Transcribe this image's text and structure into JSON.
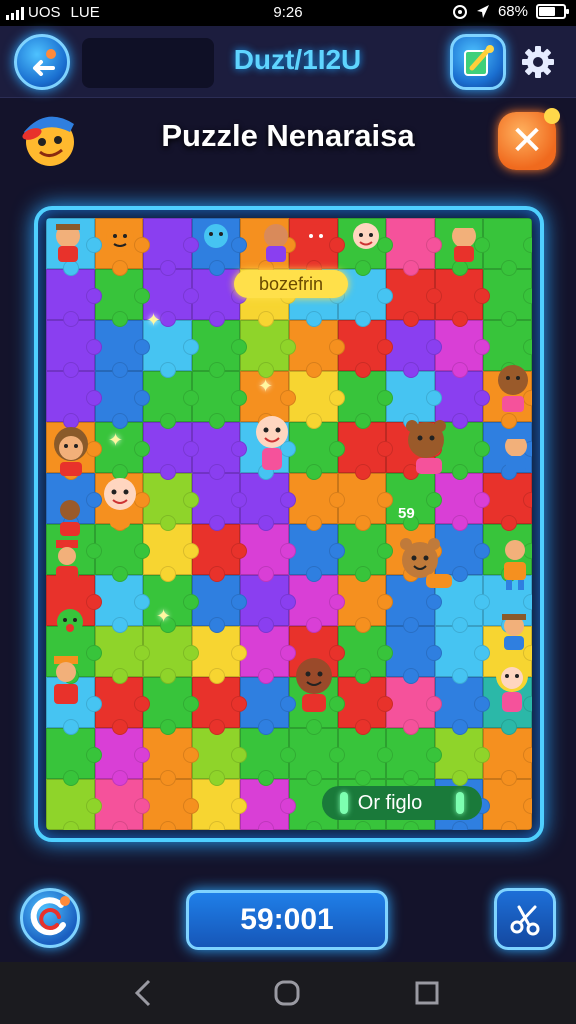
{
  "status_bar": {
    "carrier": "UOS",
    "network": "LUE",
    "time": "9:26",
    "battery": "68%",
    "battery_level": 0.68
  },
  "top_bar": {
    "title": "Duzt/1I2U",
    "icons": [
      "back-icon",
      "edit-icon",
      "gear-icon"
    ]
  },
  "header": {
    "title": "Puzzle Nenaraisa",
    "icons": [
      "mascot-icon",
      "close-icon"
    ]
  },
  "board": {
    "tag_label": "bozefrin",
    "score_text": "59",
    "pill_label": "Or figlo",
    "colors": {
      "red": "#e8322b",
      "orange": "#f5901f",
      "yellow": "#f7d531",
      "green": "#38c43b",
      "lime": "#8fd42a",
      "blue": "#2f7fe0",
      "sky": "#46c4f2",
      "purple": "#8a3ff0",
      "magenta": "#d93fd6",
      "pink": "#f5529b",
      "teal": "#2bb8a8"
    }
  },
  "controls": {
    "timer": "59:001",
    "icons": [
      "hint-icon",
      "scissors-icon"
    ]
  },
  "nav_bar": {
    "icons": [
      "nav-back-icon",
      "nav-home-icon",
      "nav-recents-icon"
    ]
  },
  "colors": {
    "background": "#14132b",
    "accent": "#4fd0ff",
    "close": "#f06a1e"
  }
}
